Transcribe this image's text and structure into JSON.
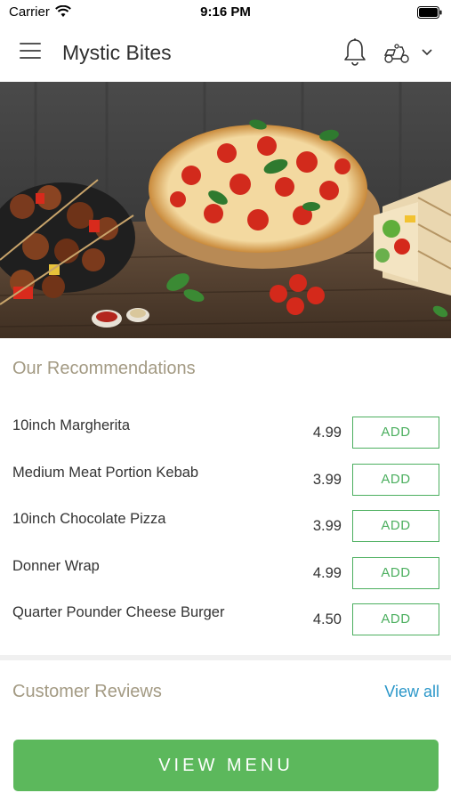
{
  "status_bar": {
    "carrier": "Carrier",
    "time": "9:16 PM"
  },
  "header": {
    "title": "Mystic Bites"
  },
  "recommendations": {
    "title": "Our Recommendations",
    "items": [
      {
        "name": "10inch Margherita",
        "price": "4.99",
        "action": "ADD"
      },
      {
        "name": "Medium Meat Portion Kebab",
        "price": "3.99",
        "action": "ADD"
      },
      {
        "name": "10inch Chocolate Pizza",
        "price": "3.99",
        "action": "ADD"
      },
      {
        "name": "Donner Wrap",
        "price": "4.99",
        "action": "ADD"
      },
      {
        "name": "Quarter Pounder Cheese Burger",
        "price": "4.50",
        "action": "ADD"
      }
    ]
  },
  "reviews": {
    "title": "Customer Reviews",
    "view_all": "View all"
  },
  "cta": {
    "label": "VIEW MENU"
  },
  "colors": {
    "accent_green": "#5cb85c",
    "section_title": "#a39a83",
    "link_blue": "#2b97c9"
  }
}
